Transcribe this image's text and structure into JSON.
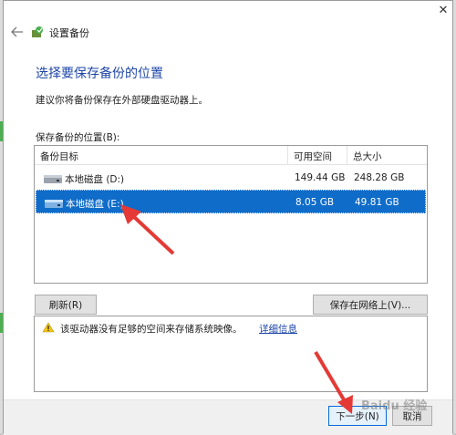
{
  "window": {
    "title": "设置备份",
    "close_glyph": "✕"
  },
  "heading": "选择要保存备份的位置",
  "subtext": "建议你将备份保存在外部硬盘驱动器上。",
  "location_label": "保存备份的位置(B):",
  "table": {
    "columns": [
      "备份目标",
      "可用空间",
      "总大小"
    ],
    "rows": [
      {
        "name": "本地磁盘 (D:)",
        "free": "149.44 GB",
        "total": "248.28 GB",
        "selected": false
      },
      {
        "name": "本地磁盘 (E:)",
        "free": "8.05 GB",
        "total": "49.81 GB",
        "selected": true
      }
    ]
  },
  "buttons": {
    "refresh": "刷新(R)",
    "save_network": "保存在网络上(V)...",
    "next": "下一步(N)",
    "cancel": "取消"
  },
  "warning": {
    "text": "该驱动器没有足够的空间来存储系统映像。",
    "link": "详细信息"
  },
  "watermark": "Baidu 经验",
  "colors": {
    "heading_blue": "#1e46a8",
    "selection_blue": "#0f6cc9",
    "annotation_red": "#e53935"
  }
}
